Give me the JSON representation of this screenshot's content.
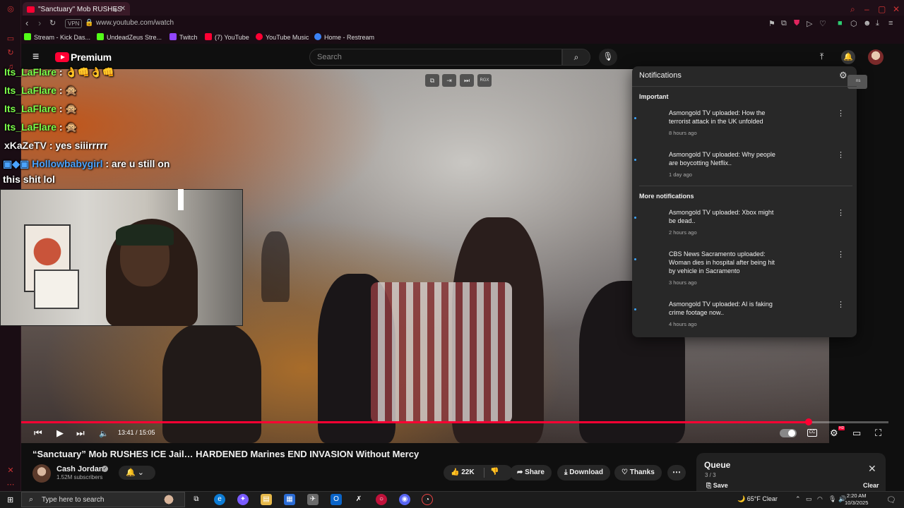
{
  "browser": {
    "tab_title": "\"Sanctuary\" Mob RUSHES",
    "url": "www.youtube.com/watch",
    "vpn_label": "VPN",
    "bookmarks": [
      {
        "label": "Stream - Kick Das...",
        "color": "#53fc18"
      },
      {
        "label": "UndeadZeus Stre...",
        "color": "#53fc18"
      },
      {
        "label": "Twitch",
        "color": "#9146ff"
      },
      {
        "label": "(7) YouTube",
        "color": "#ff0033"
      },
      {
        "label": "YouTube Music",
        "color": "#ff0033"
      },
      {
        "label": "Home - Restream",
        "color": "#3b82f6"
      }
    ]
  },
  "youtube": {
    "logo_label": "Premium",
    "search_placeholder": "Search"
  },
  "video": {
    "title": "“Sanctuary” Mob RUSHES ICE Jail… HARDENED Marines END INVASION Without Mercy",
    "current_time": "13:41 / 15:05",
    "progress_fraction": 0.9076,
    "overlay_badge": "RGX"
  },
  "chat_overlay": [
    {
      "user": "Its_LaFlare",
      "message": ": 👌👊👌👊",
      "user_color": "u1"
    },
    {
      "user": "Its_LaFlare",
      "message": ": 🙊",
      "user_color": "u1"
    },
    {
      "user": "Its_LaFlare",
      "message": ": 🙊",
      "user_color": "u1"
    },
    {
      "user": "Its_LaFlare",
      "message": ": 🙊",
      "user_color": "u1"
    },
    {
      "user": "xKaZeTV",
      "message": ": yes siiirrrrr",
      "user_color": "u2"
    },
    {
      "user": "Hollowbabygirl",
      "message": ": are u still on",
      "user_color": "u3"
    },
    {
      "user": "",
      "message": "this shit lol",
      "user_color": "u2"
    }
  ],
  "channel": {
    "name": "Cash Jordan",
    "subscribers": "1.52M subscribers"
  },
  "actions": {
    "likes": "22K",
    "share": "Share",
    "download": "Download",
    "thanks": "Thanks"
  },
  "queue": {
    "title": "Queue",
    "count": "3 / 3",
    "save": "Save",
    "clear": "Clear"
  },
  "notifications": {
    "title": "Notifications",
    "section_important": "Important",
    "section_more": "More notifications",
    "tooltip": "ns",
    "items": [
      {
        "text": "Asmongold TV uploaded: How the terrorist attack in the UK unfolded",
        "ago": "8 hours ago"
      },
      {
        "text": "Asmongold TV uploaded: Why people are boycotting Netflix..",
        "ago": "1 day ago"
      },
      {
        "text": "Asmongold TV uploaded: Xbox might be dead..",
        "ago": "2 hours ago"
      },
      {
        "text": "CBS News Sacramento uploaded: Woman dies in hospital after being hit by vehicle in Sacramento",
        "ago": "3 hours ago"
      },
      {
        "text": "Asmongold TV uploaded: AI is faking crime footage now..",
        "ago": "4 hours ago"
      }
    ]
  },
  "taskbar": {
    "search_placeholder": "Type here to search",
    "weather": "65°F  Clear",
    "time": "2:20 AM",
    "date": "10/3/2025"
  }
}
